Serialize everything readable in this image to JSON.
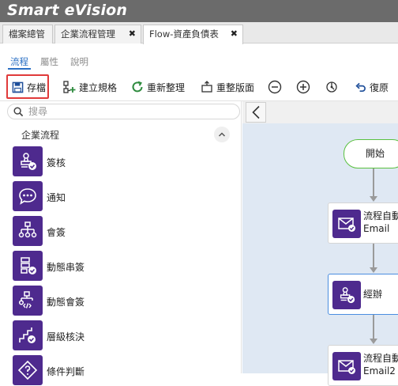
{
  "app": {
    "title": "Smart eVision"
  },
  "tabs": [
    {
      "label": "檔案總管",
      "closable": false
    },
    {
      "label": "企業流程管理",
      "closable": true
    },
    {
      "label": "Flow-資產負債表",
      "closable": true,
      "active": true
    }
  ],
  "close_glyph": "✖",
  "subtabs": [
    {
      "label": "流程",
      "active": true
    },
    {
      "label": "屬性"
    },
    {
      "label": "說明"
    }
  ],
  "toolbar": {
    "save": "存檔",
    "create_spec": "建立規格",
    "reorganize": "重新整理",
    "fit_page": "重整版面",
    "restore": "復原"
  },
  "search": {
    "placeholder": "搜尋",
    "value": ""
  },
  "palette": {
    "group": "企業流程",
    "items": [
      {
        "label": "簽核",
        "icon": "approve-stamp-icon"
      },
      {
        "label": "通知",
        "icon": "chat-bubble-icon"
      },
      {
        "label": "會簽",
        "icon": "countersign-tree-icon"
      },
      {
        "label": "動態串簽",
        "icon": "dynamic-serial-sign-icon"
      },
      {
        "label": "動態會簽",
        "icon": "dynamic-countersign-icon"
      },
      {
        "label": "層級核決",
        "icon": "level-approval-icon"
      },
      {
        "label": "條件判斷",
        "icon": "condition-diamond-icon"
      }
    ]
  },
  "flow": {
    "start": "開始",
    "nodes": [
      {
        "line1": "流程自動",
        "line2": "Email",
        "icon": "email-icon"
      },
      {
        "line1": "經辦",
        "line2": "",
        "icon": "approve-stamp-icon",
        "selected": true
      },
      {
        "line1": "流程自動",
        "line2": "Email2",
        "icon": "email-icon"
      }
    ]
  },
  "colors": {
    "accent": "#2a6fc4",
    "icon_bg": "#4e2a8e",
    "highlight": "#e03a3a",
    "start_border": "#59c040"
  }
}
